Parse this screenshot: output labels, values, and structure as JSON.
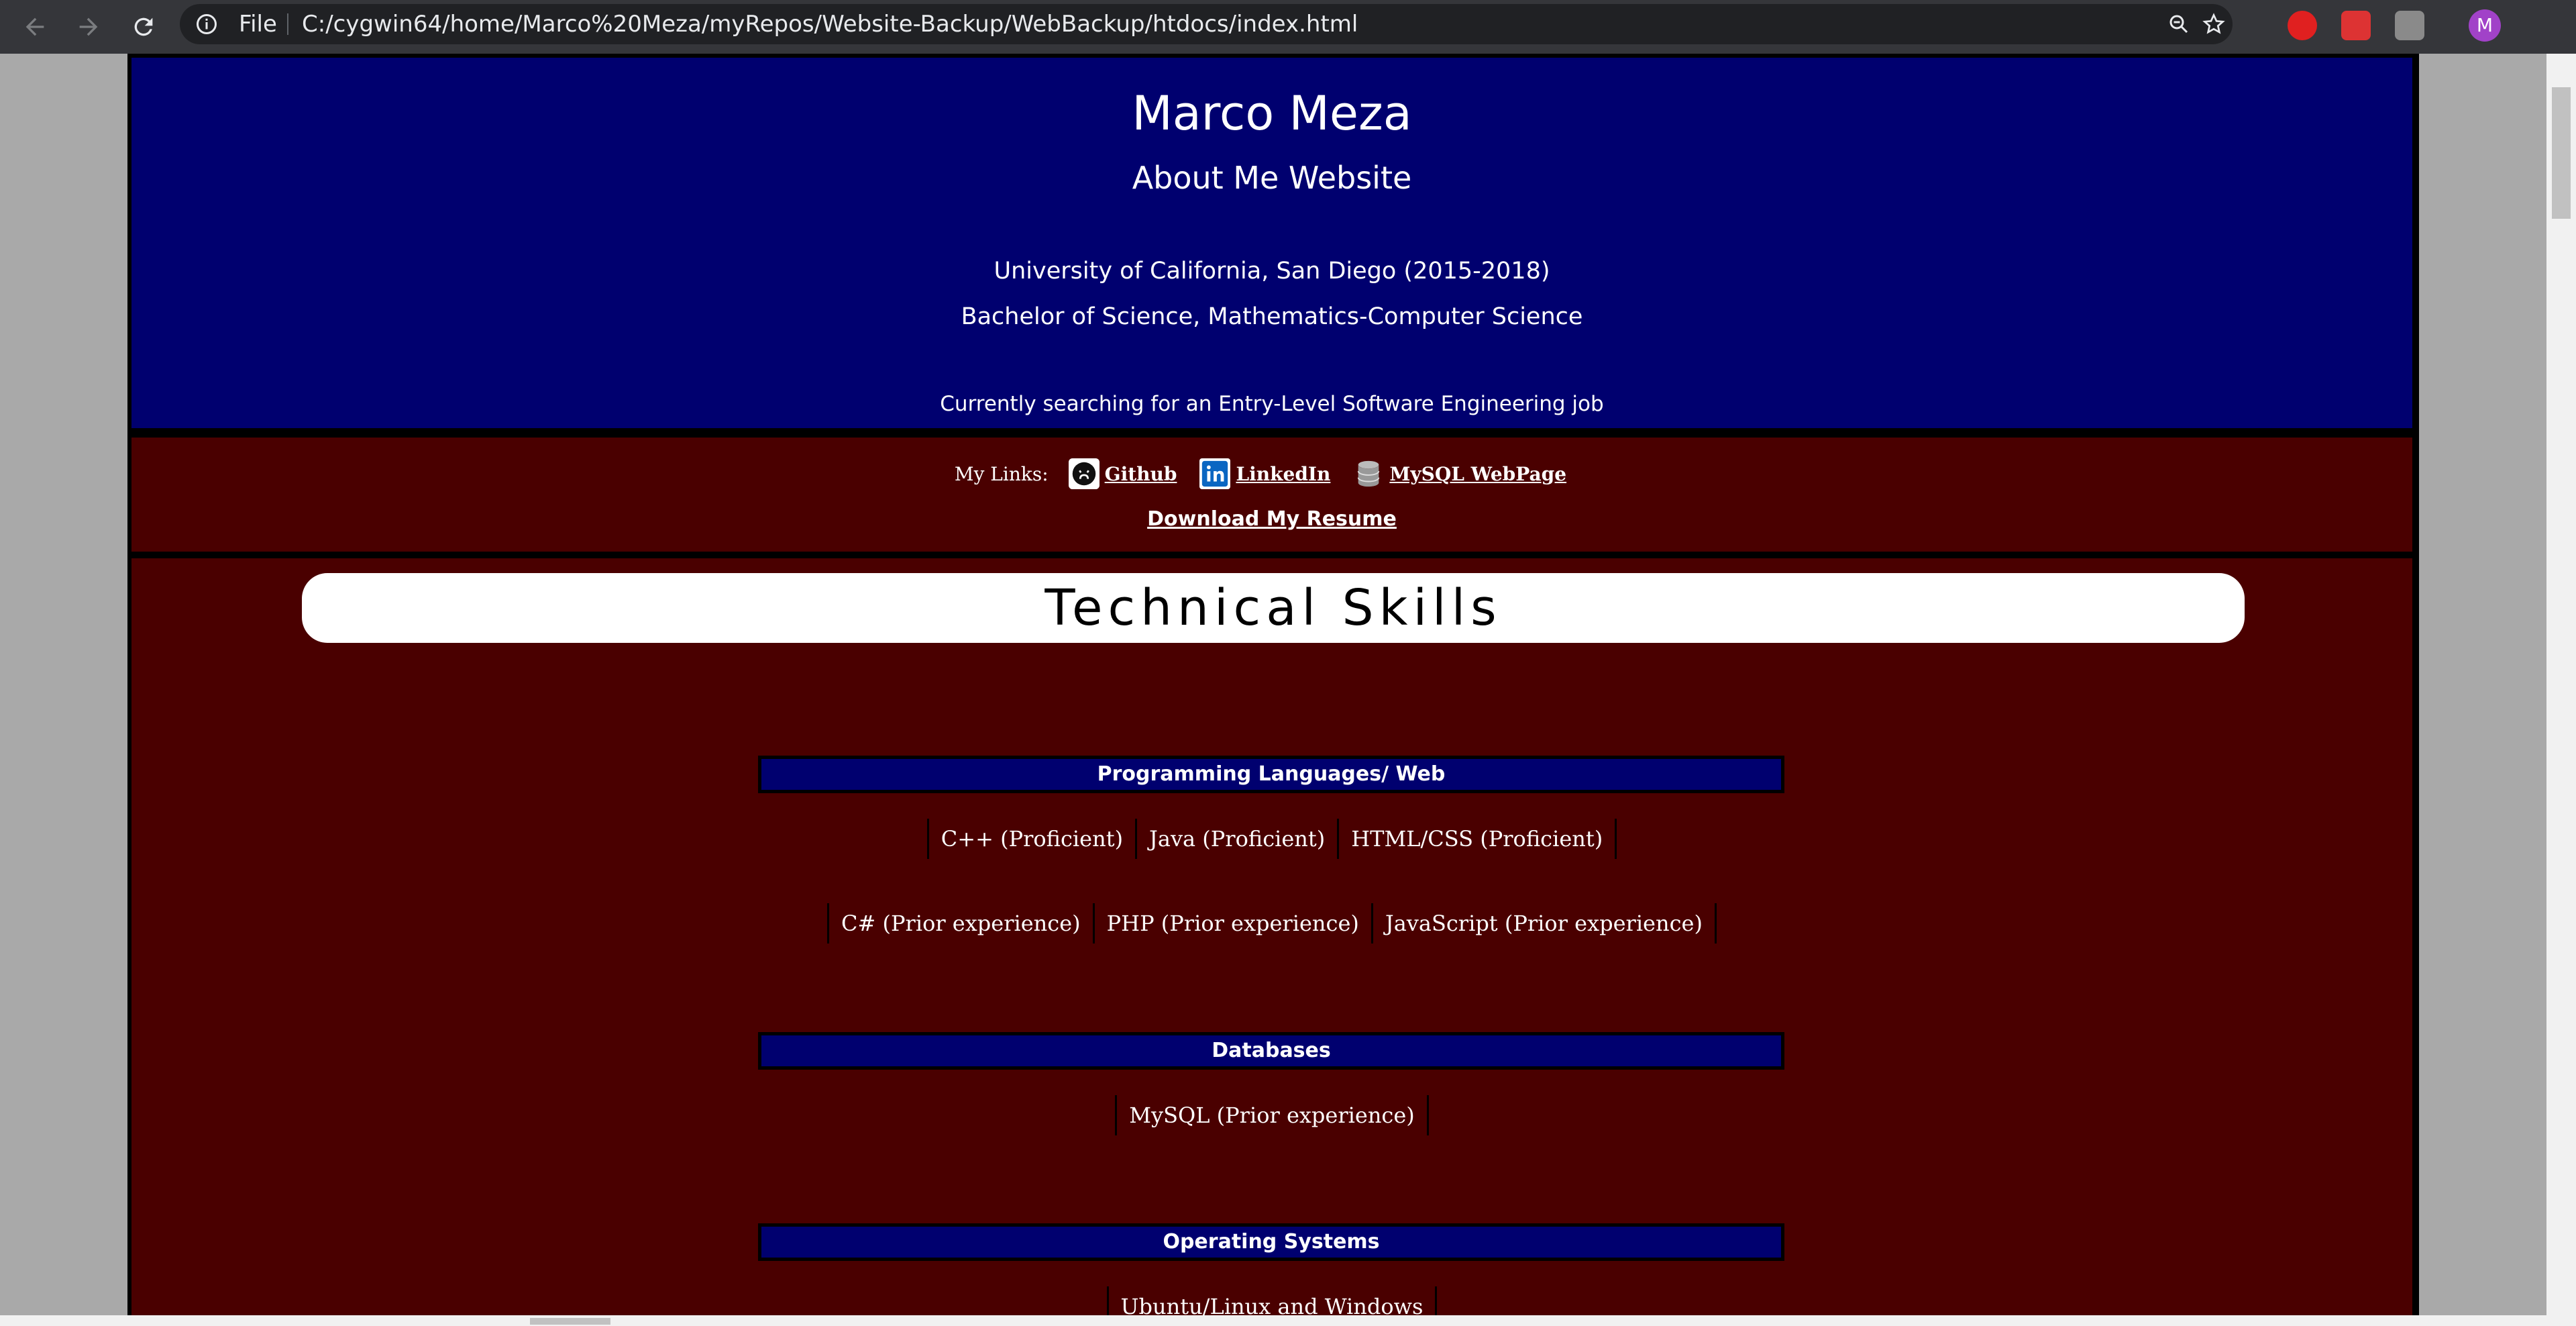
{
  "browser": {
    "file_label": "File",
    "url": "C:/cygwin64/home/Marco%20Meza/myRepos/Website-Backup/WebBackup/htdocs/index.html",
    "profile_initial": "M",
    "icons": [
      "back-arrow-icon",
      "forward-arrow-icon",
      "reload-icon",
      "info-icon",
      "zoom-icon",
      "star-icon"
    ]
  },
  "header": {
    "name": "Marco Meza",
    "subtitle": "About Me Website",
    "school": "University of California, San Diego (2015-2018)",
    "degree": "Bachelor of Science, Mathematics-Computer Science",
    "status": "Currently searching for an Entry-Level Software Engineering job"
  },
  "links": {
    "label": "My Links:",
    "items": [
      {
        "label": "Github",
        "icon": "github-icon"
      },
      {
        "label": "LinkedIn",
        "icon": "linkedin-icon"
      },
      {
        "label": "MySQL WebPage",
        "icon": "database-icon"
      }
    ],
    "resume": "Download My Resume"
  },
  "skills": {
    "title": "Technical Skills",
    "categories": [
      {
        "name": "Programming Languages/ Web",
        "rows": [
          [
            "C++ (Proficient)",
            "Java (Proficient)",
            "HTML/CSS (Proficient)"
          ],
          [
            "C# (Prior experience)",
            "PHP (Prior experience)",
            "JavaScript (Prior experience)"
          ]
        ]
      },
      {
        "name": "Databases",
        "rows": [
          [
            "MySQL (Prior experience)"
          ]
        ]
      },
      {
        "name": "Operating Systems",
        "rows": [
          [
            "Ubuntu/Linux and Windows"
          ]
        ]
      }
    ]
  },
  "colors": {
    "header_bg": "#00006f",
    "section_bg": "#4a0000",
    "chrome_bg": "#35363a"
  }
}
